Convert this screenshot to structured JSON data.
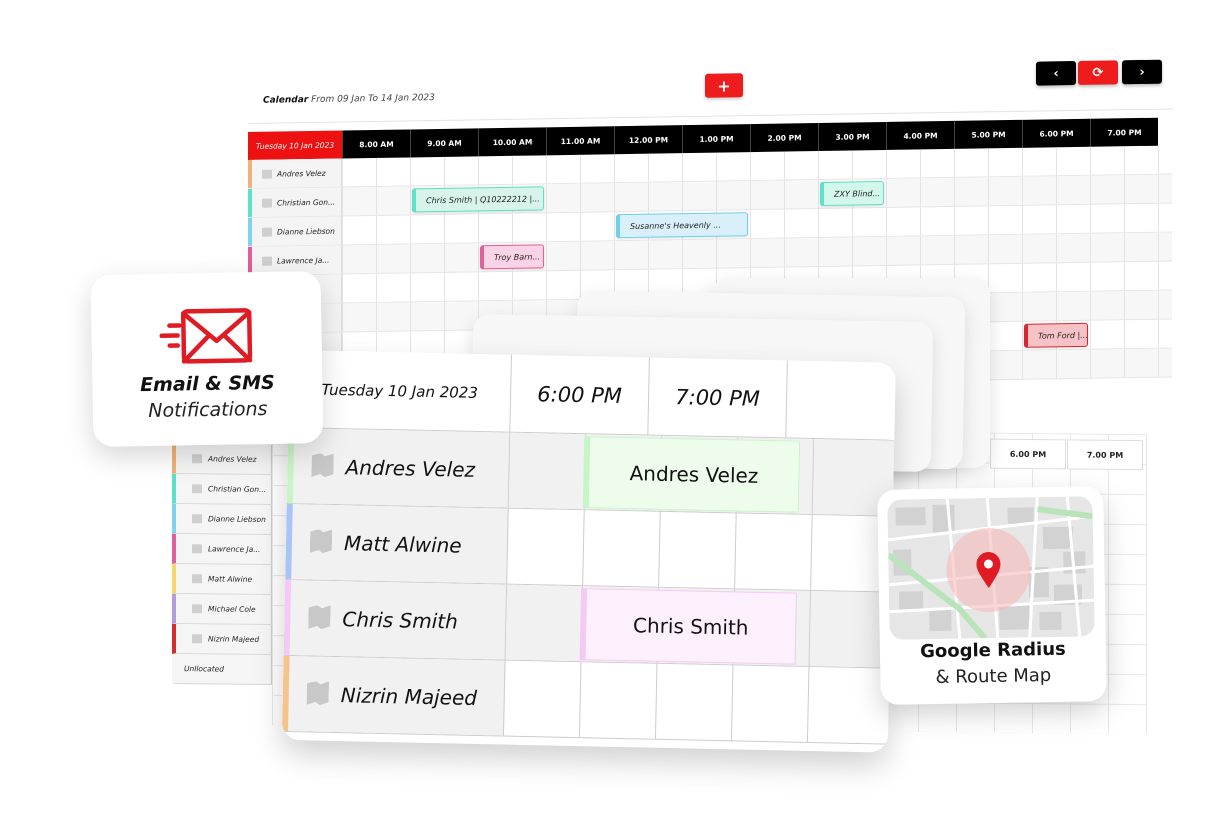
{
  "calendar": {
    "title": "Calendar",
    "range": "From 09 Jan To 14 Jan 2023",
    "add_label": "+",
    "prev_label": "‹",
    "refresh_label": "⟳",
    "next_label": "›",
    "day": "Tuesday 10 Jan 2023",
    "hours": [
      "8.00 AM",
      "9.00 AM",
      "10.00 AM",
      "11.00 AM",
      "12.00 PM",
      "1.00 PM",
      "2.00 PM",
      "3.00 PM",
      "4.00 PM",
      "5.00 PM",
      "6.00 PM",
      "7.00 PM"
    ],
    "resources": [
      {
        "name": "Andres Velez",
        "color": "#f0b27a"
      },
      {
        "name": "Christian Gon...",
        "color": "#5fe0c8"
      },
      {
        "name": "Dianne Liebson",
        "color": "#7fd3ee"
      },
      {
        "name": "Lawrence Ja...",
        "color": "#e0609a"
      },
      {
        "name": "",
        "color": "transparent"
      },
      {
        "name": "",
        "color": "transparent"
      },
      {
        "name": "",
        "color": "transparent"
      },
      {
        "name": "",
        "color": "transparent"
      }
    ],
    "events": [
      {
        "label": "Chris Smith | Q10222212 |...",
        "row": 1,
        "start": 2,
        "span": 4,
        "bg": "#d8f3ea",
        "accent": "#5fe0c8"
      },
      {
        "label": "ZXY Blind...",
        "row": 1,
        "start": 14,
        "span": 2,
        "bg": "#d4f7ec",
        "accent": "#5fe0c8"
      },
      {
        "label": "Susanne's Heavenly ...",
        "row": 2,
        "start": 8,
        "span": 4,
        "bg": "#d9f0fa",
        "accent": "#6fd0ea"
      },
      {
        "label": "Troy Barn...",
        "row": 3,
        "start": 4,
        "span": 2,
        "bg": "#fbd3e6",
        "accent": "#e0609a"
      },
      {
        "label": "Tom Ford |...",
        "row": 6,
        "start": 20,
        "span": 2,
        "bg": "#f6c2c6",
        "accent": "#d9262e"
      }
    ]
  },
  "calendar_lower": {
    "hours": [
      "6.00 PM",
      "7.00 PM"
    ],
    "resources": [
      {
        "name": "Andres Velez",
        "color": "#f0b27a"
      },
      {
        "name": "Christian Gon...",
        "color": "#5fe0c8"
      },
      {
        "name": "Dianne Liebson",
        "color": "#7fd3ee"
      },
      {
        "name": "Lawrence Ja...",
        "color": "#e0609a"
      },
      {
        "name": "Matt Alwine",
        "color": "#f5d76e"
      },
      {
        "name": "Michael Cole",
        "color": "#b39ddb"
      },
      {
        "name": "Nizrin Majeed",
        "color": "#d32f2f"
      },
      {
        "name": "Unllocated",
        "color": "transparent"
      }
    ]
  },
  "front_card": {
    "day": "Tuesday 10 Jan 2023",
    "times": [
      "6:00 PM",
      "7:00 PM"
    ],
    "rows": [
      {
        "name": "Andres Velez",
        "color": "#c8f5c8",
        "event": "Andres Velez",
        "event_bg": "#eefcec",
        "event_accent": "#c8f5c8"
      },
      {
        "name": "Matt Alwine",
        "color": "#a9c4f5",
        "event": "",
        "event_bg": "",
        "event_accent": ""
      },
      {
        "name": "Chris Smith",
        "color": "#f4c9f4",
        "event": "Chris Smith",
        "event_bg": "#fcf0fc",
        "event_accent": "#f4c9f4"
      },
      {
        "name": "Nizrin Majeed",
        "color": "#f6c38a",
        "event": "",
        "event_bg": "",
        "event_accent": ""
      }
    ]
  },
  "email_card": {
    "icon": "envelope-fast-icon",
    "title": "Email & SMS",
    "subtitle": "Notifications",
    "accent": "#e01b24"
  },
  "map_card": {
    "icon": "map-pin-icon",
    "title": "Google Radius",
    "subtitle": "& Route Map",
    "accent": "#e01b24"
  }
}
